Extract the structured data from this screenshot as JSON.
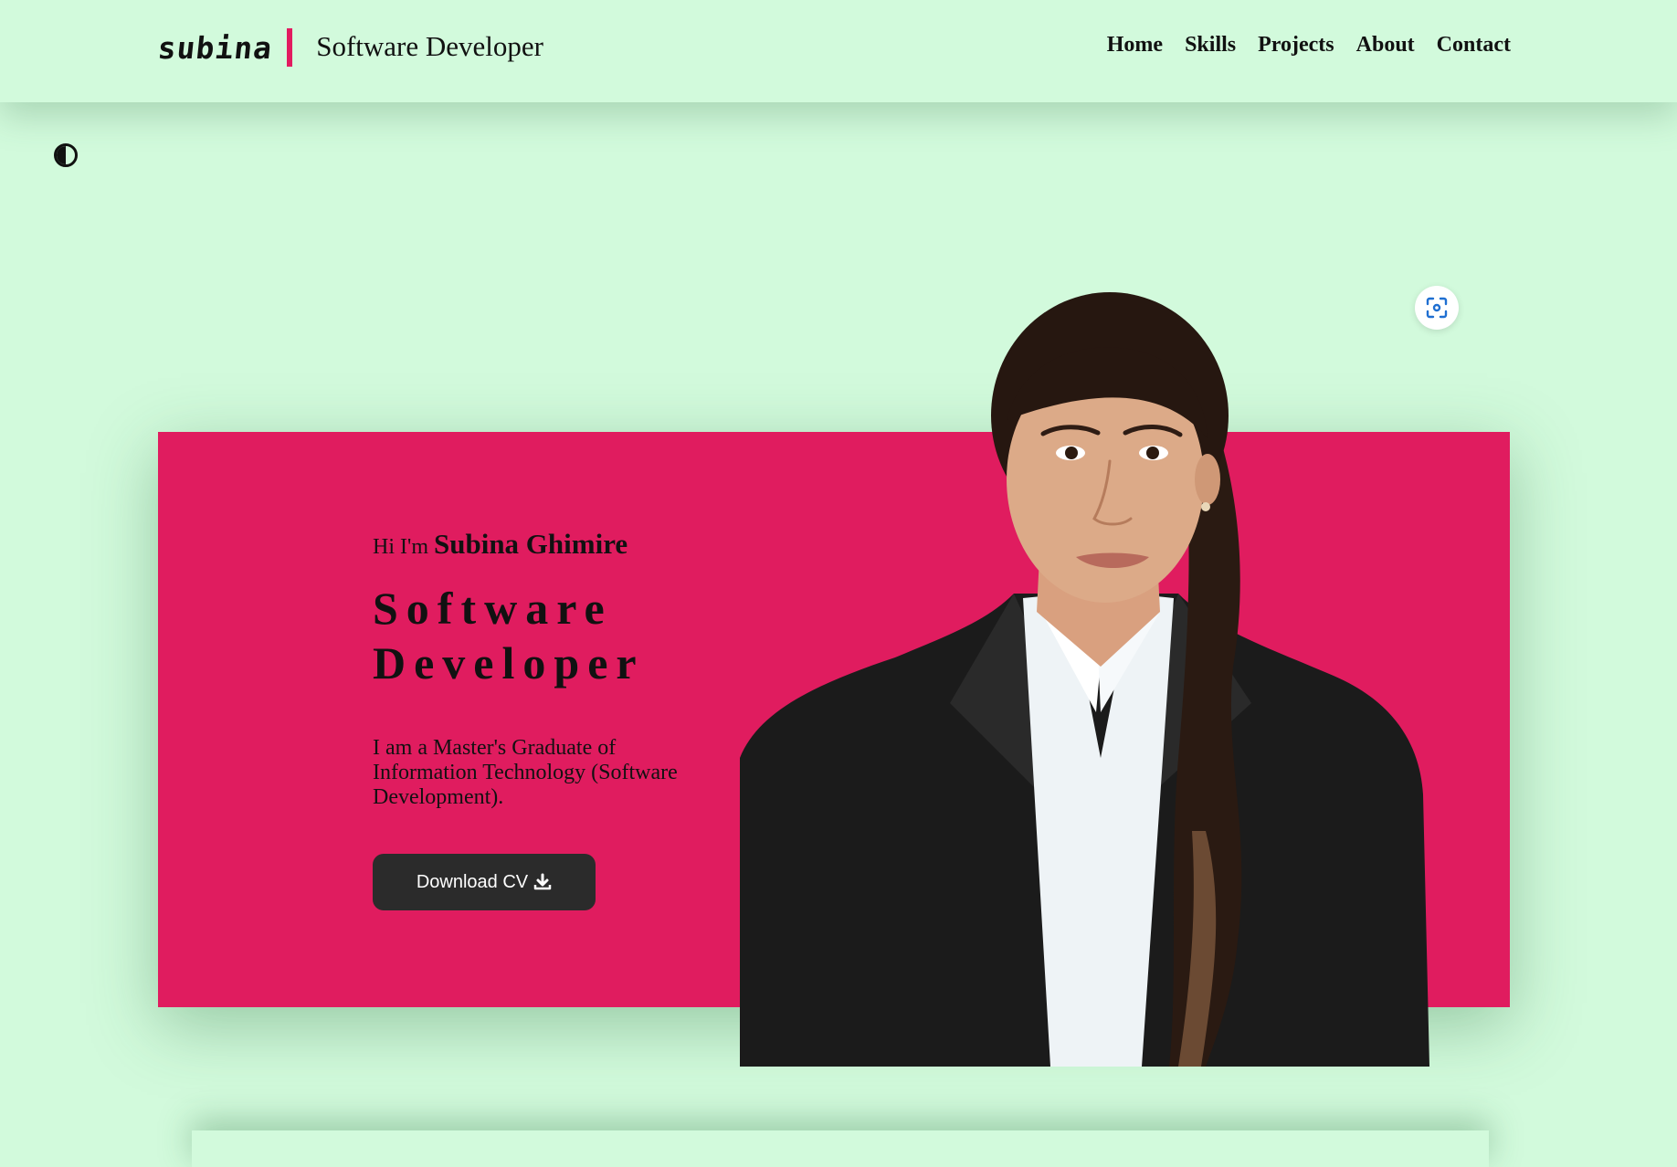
{
  "header": {
    "logo": "subina",
    "role": "Software Developer",
    "nav": [
      "Home",
      "Skills",
      "Projects",
      "About",
      "Contact"
    ]
  },
  "theme_toggle_icon": "contrast-icon",
  "scan_icon": "scan-icon",
  "hero": {
    "greeting_prefix": "Hi I'm",
    "name": "Subina Ghimire",
    "title_line1": "Software",
    "title_line2": "Developer",
    "description": "I am a Master's Graduate of Information Technology (Software Development).",
    "cv_button": "Download CV",
    "cv_icon": "download-icon"
  },
  "colors": {
    "background": "#d2fadc",
    "accent": "#e01c5f",
    "button": "#2b2b2b"
  }
}
